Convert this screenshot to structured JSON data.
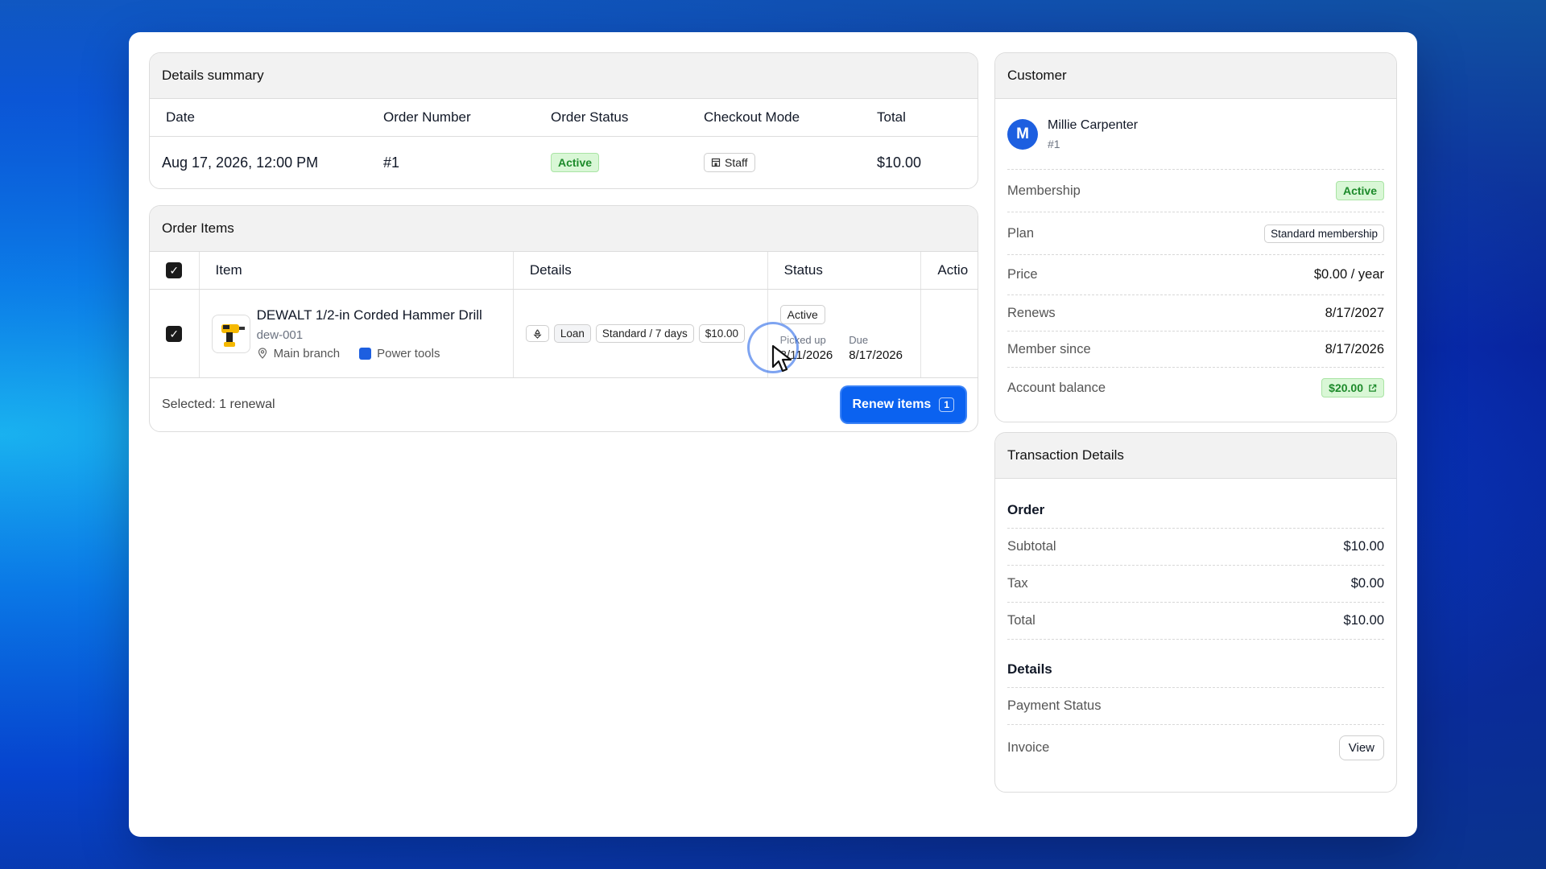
{
  "summary": {
    "title": "Details summary",
    "headers": [
      "Date",
      "Order Number",
      "Order Status",
      "Checkout Mode",
      "Total"
    ],
    "row": {
      "date": "Aug 17, 2026, 12:00 PM",
      "order_number": "#1",
      "order_status": "Active",
      "checkout_mode": "Staff",
      "total": "$10.00"
    }
  },
  "order_items": {
    "title": "Order Items",
    "headers": [
      "Item",
      "Details",
      "Status",
      "Actio"
    ],
    "items": [
      {
        "name": "DEWALT 1/2-in Corded Hammer Drill",
        "sku": "dew-001",
        "location": "Main branch",
        "category": "Power tools",
        "type": "Loan",
        "plan": "Standard / 7 days",
        "price": "$10.00",
        "status": "Active",
        "picked_up_label": "Picked up",
        "picked_up": "8/11/2026",
        "due_label": "Due",
        "due": "8/17/2026"
      }
    ],
    "selected_text": "Selected: 1 renewal",
    "renew_label": "Renew items",
    "renew_count": "1"
  },
  "customer": {
    "title": "Customer",
    "avatar_initial": "M",
    "name": "Millie Carpenter",
    "number": "#1",
    "membership_label": "Membership",
    "membership_value": "Active",
    "plan_label": "Plan",
    "plan_value": "Standard membership",
    "price_label": "Price",
    "price_value": "$0.00 / year",
    "renews_label": "Renews",
    "renews_value": "8/17/2027",
    "member_since_label": "Member since",
    "member_since_value": "8/17/2026",
    "balance_label": "Account balance",
    "balance_value": "$20.00"
  },
  "transaction": {
    "title": "Transaction Details",
    "order_section": "Order",
    "subtotal_label": "Subtotal",
    "subtotal_value": "$10.00",
    "tax_label": "Tax",
    "tax_value": "$0.00",
    "total_label": "Total",
    "total_value": "$10.00",
    "details_section": "Details",
    "payment_status_label": "Payment Status",
    "invoice_label": "Invoice",
    "view_label": "View"
  },
  "colors": {
    "accent": "#0b62f0",
    "success_bg": "#d9f7d6",
    "success_text": "#1c8a2a"
  }
}
